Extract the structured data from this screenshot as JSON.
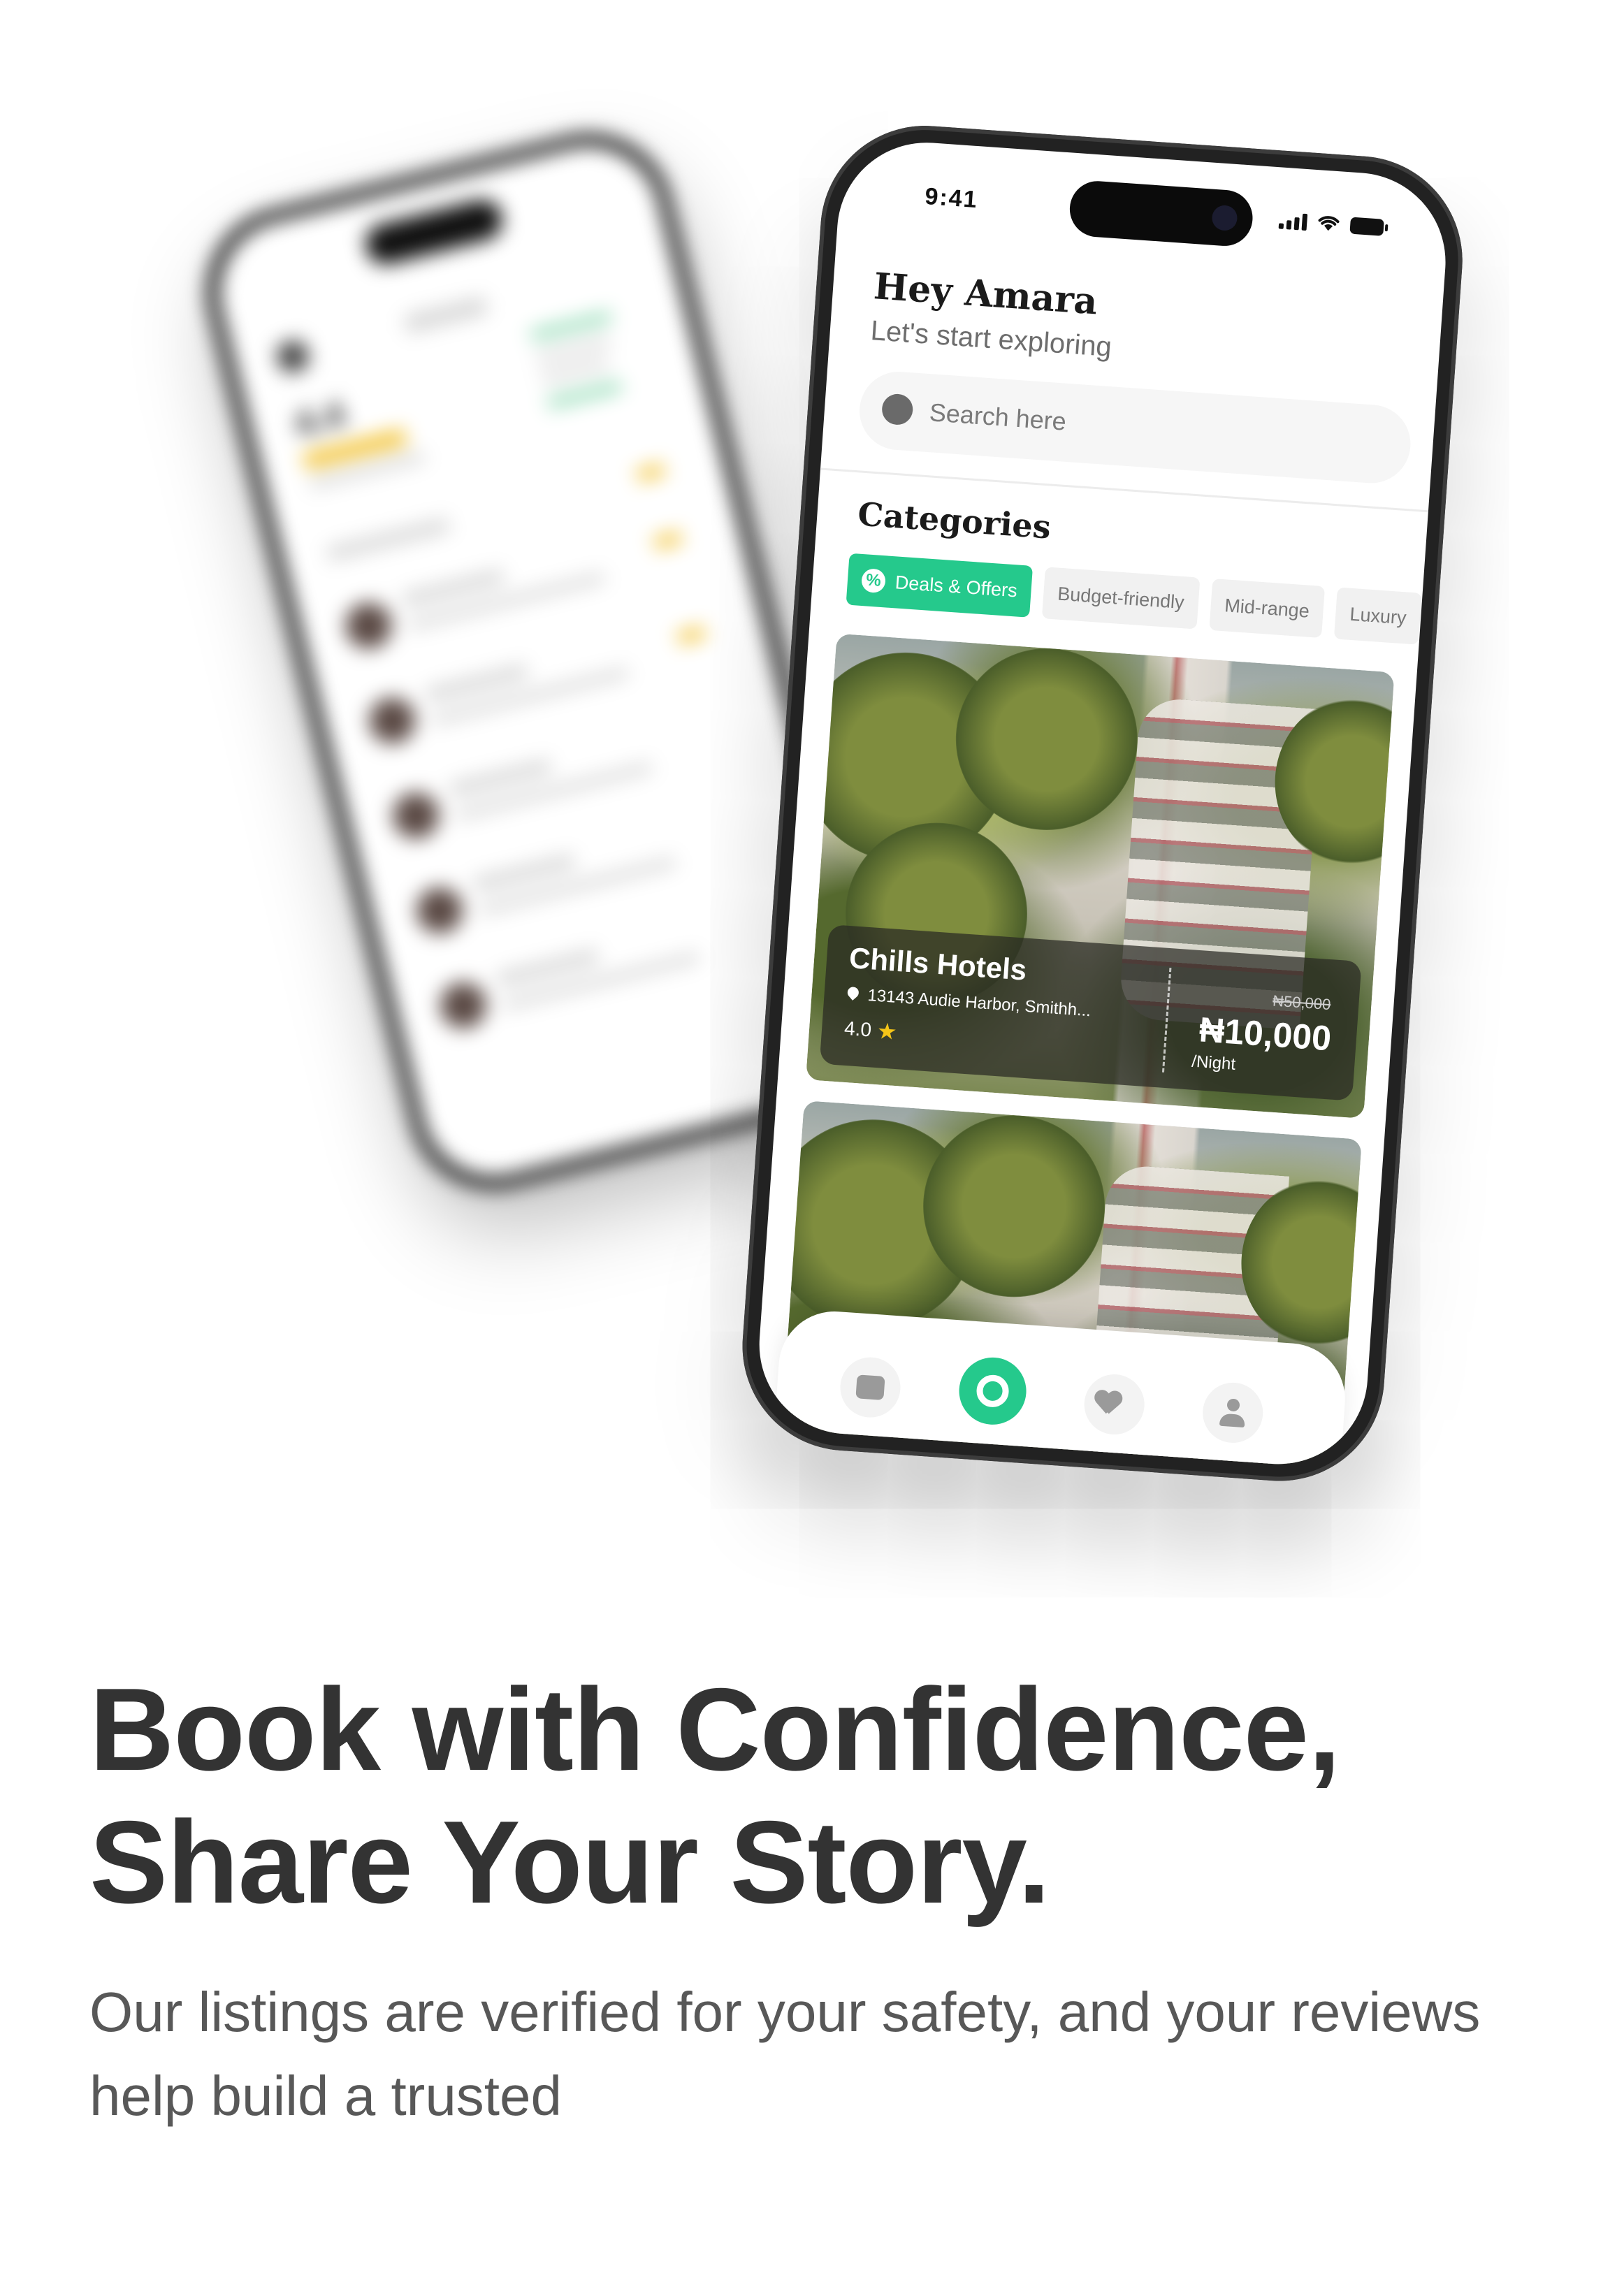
{
  "status_bar": {
    "time": "9:41"
  },
  "home": {
    "greeting": "Hey Amara",
    "subtitle": "Let's start exploring",
    "search_placeholder": "Search here",
    "categories_title": "Categories",
    "categories": [
      "Deals & Offers",
      "Budget-friendly",
      "Mid-range",
      "Luxury"
    ],
    "active_category": "Deals & Offers"
  },
  "listing": {
    "name": "Chills Hotels",
    "address": "13143 Audie Harbor, Smithh...",
    "rating": "4.0",
    "old_price": "₦50,000",
    "price": "₦10,000",
    "unit": "/Night"
  },
  "bottom_nav": {
    "items": [
      "map-icon",
      "search-icon",
      "heart-icon",
      "user-icon"
    ],
    "active": "search-icon"
  },
  "back_phone": {
    "rating": "4.4"
  },
  "marketing": {
    "headline_line1": "Book with Confidence,",
    "headline_line2": "Share Your Story.",
    "subtext": "Our listings are verified for your safety, and your reviews help build a trusted"
  },
  "colors": {
    "accent": "#25c98c",
    "text_dark": "#333333",
    "text_muted": "#585858",
    "star": "#f5c518"
  }
}
